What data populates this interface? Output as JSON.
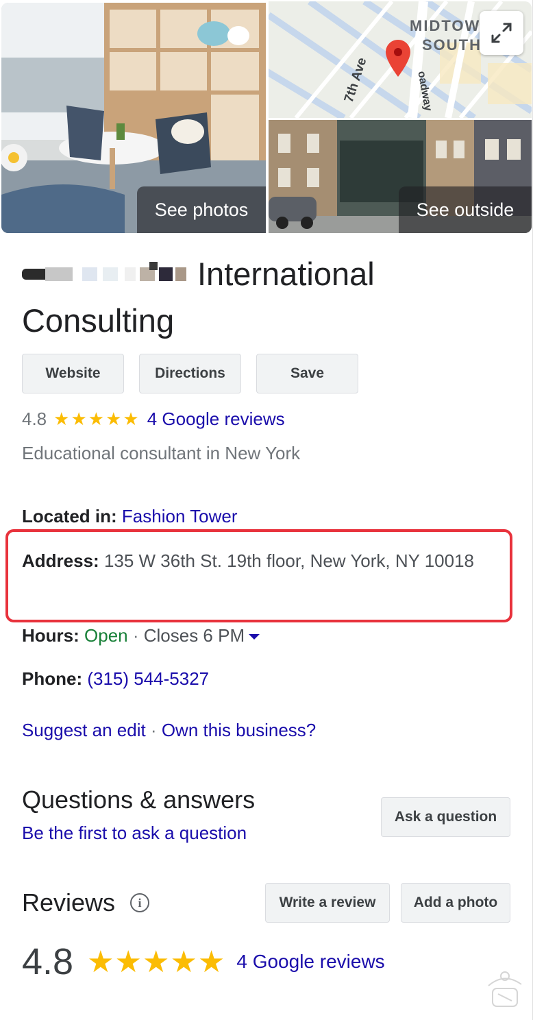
{
  "media": {
    "see_photos_label": "See photos",
    "see_outside_label": "See outside",
    "map_district_line1": "MIDTOWN",
    "map_district_line2": "SOUTH",
    "map_street_1": "7th Ave",
    "map_street_2": "oadway"
  },
  "business": {
    "name_visible": "International",
    "name_line2": "Consulting"
  },
  "actions": {
    "website": "Website",
    "directions": "Directions",
    "save": "Save"
  },
  "rating": {
    "value": "4.8",
    "stars": 5,
    "reviews_link": "4 Google reviews"
  },
  "category": "Educational consultant in New York",
  "details": {
    "located_label": "Located in:",
    "located_value": "Fashion Tower",
    "address_label": "Address:",
    "address_value": "135 W 36th St. 19th floor, New York, NY 10018",
    "hours_label": "Hours:",
    "hours_status": "Open",
    "hours_sep": " · ",
    "hours_detail": "Closes 6 PM",
    "phone_label": "Phone:",
    "phone_value": "(315) 544-5327"
  },
  "edit": {
    "suggest": "Suggest an edit",
    "sep": " · ",
    "own": "Own this business?"
  },
  "qa": {
    "title": "Questions & answers",
    "subtitle": "Be the first to ask a question",
    "ask_button": "Ask a question"
  },
  "reviews": {
    "title": "Reviews",
    "write_button": "Write a review",
    "photo_button": "Add a photo",
    "summary_value": "4.8",
    "summary_link": "4 Google reviews"
  },
  "colors": {
    "link": "#1a0dab",
    "open": "#188038",
    "star": "#fbbc04",
    "highlight": "#e8323c"
  }
}
